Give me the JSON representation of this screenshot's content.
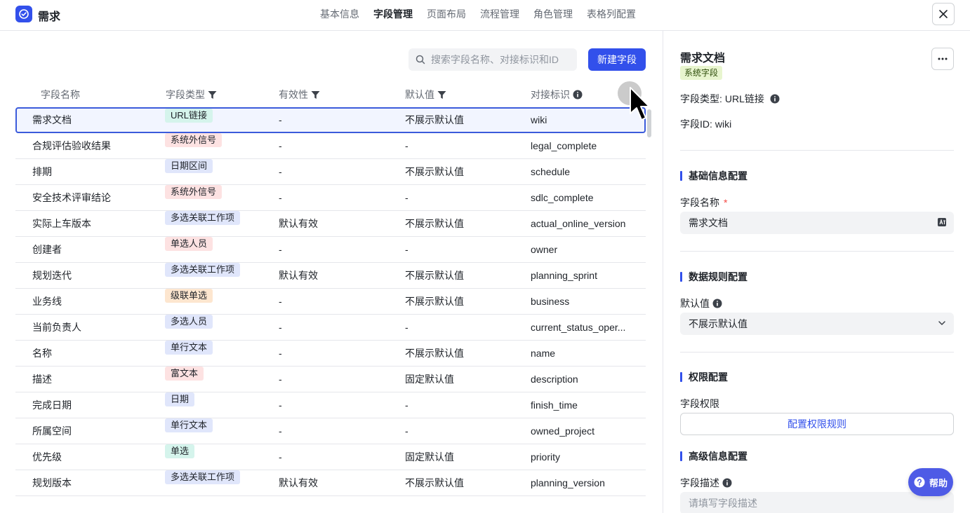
{
  "app": {
    "title": "需求"
  },
  "tabs": [
    {
      "label": "基本信息",
      "active": false
    },
    {
      "label": "字段管理",
      "active": true
    },
    {
      "label": "页面布局",
      "active": false
    },
    {
      "label": "流程管理",
      "active": false
    },
    {
      "label": "角色管理",
      "active": false
    },
    {
      "label": "表格列配置",
      "active": false
    }
  ],
  "toolbar": {
    "search_placeholder": "搜索字段名称、对接标识和ID",
    "new_button": "新建字段"
  },
  "table": {
    "headers": {
      "name": "字段名称",
      "type": "字段类型",
      "valid": "有效性",
      "default": "默认值",
      "key": "对接标识"
    },
    "rows": [
      {
        "name": "需求文档",
        "type": "URL链接",
        "type_color": "teal",
        "valid": "-",
        "default": "不展示默认值",
        "key": "wiki",
        "selected": true
      },
      {
        "name": "合规评估验收结果",
        "type": "系统外信号",
        "type_color": "red",
        "valid": "-",
        "default": "-",
        "key": "legal_complete"
      },
      {
        "name": "排期",
        "type": "日期区间",
        "type_color": "indigo",
        "valid": "-",
        "default": "不展示默认值",
        "key": "schedule"
      },
      {
        "name": "安全技术评审结论",
        "type": "系统外信号",
        "type_color": "red",
        "valid": "-",
        "default": "-",
        "key": "sdlc_complete"
      },
      {
        "name": "实际上车版本",
        "type": "多选关联工作项",
        "type_color": "indigo",
        "valid": "默认有效",
        "default": "不展示默认值",
        "key": "actual_online_version"
      },
      {
        "name": "创建者",
        "type": "单选人员",
        "type_color": "red",
        "valid": "-",
        "default": "-",
        "key": "owner"
      },
      {
        "name": "规划迭代",
        "type": "多选关联工作项",
        "type_color": "indigo",
        "valid": "默认有效",
        "default": "不展示默认值",
        "key": "planning_sprint"
      },
      {
        "name": "业务线",
        "type": "级联单选",
        "type_color": "orange",
        "valid": "-",
        "default": "不展示默认值",
        "key": "business"
      },
      {
        "name": "当前负责人",
        "type": "多选人员",
        "type_color": "indigo",
        "valid": "-",
        "default": "-",
        "key": "current_status_oper..."
      },
      {
        "name": "名称",
        "type": "单行文本",
        "type_color": "indigo",
        "valid": "-",
        "default": "不展示默认值",
        "key": "name"
      },
      {
        "name": "描述",
        "type": "富文本",
        "type_color": "red",
        "valid": "-",
        "default": "固定默认值",
        "key": "description"
      },
      {
        "name": "完成日期",
        "type": "日期",
        "type_color": "indigo",
        "valid": "-",
        "default": "-",
        "key": "finish_time"
      },
      {
        "name": "所属空间",
        "type": "单行文本",
        "type_color": "indigo",
        "valid": "-",
        "default": "-",
        "key": "owned_project"
      },
      {
        "name": "优先级",
        "type": "单选",
        "type_color": "teal",
        "valid": "-",
        "default": "固定默认值",
        "key": "priority"
      },
      {
        "name": "规划版本",
        "type": "多选关联工作项",
        "type_color": "indigo",
        "valid": "默认有效",
        "default": "不展示默认值",
        "key": "planning_version"
      }
    ]
  },
  "tag_colors": {
    "teal": {
      "bg": "#d5f4ec",
      "fg": "#1f2329"
    },
    "red": {
      "bg": "#fde2e2",
      "fg": "#1f2329"
    },
    "indigo": {
      "bg": "#e0e6fb",
      "fg": "#1f2329"
    },
    "orange": {
      "bg": "#fde6cf",
      "fg": "#1f2329"
    }
  },
  "detail": {
    "title": "需求文档",
    "badge": "系统字段",
    "field_type_label": "字段类型:",
    "field_type_value": "URL链接",
    "field_id_label": "字段ID:",
    "field_id_value": "wiki",
    "section_basic": "基础信息配置",
    "name_label": "字段名称",
    "name_required": "*",
    "name_value": "需求文档",
    "section_data": "数据规则配置",
    "default_label": "默认值",
    "default_value": "不展示默认值",
    "section_perm": "权限配置",
    "perm_label": "字段权限",
    "perm_button": "配置权限规则",
    "section_adv": "高级信息配置",
    "desc_label": "字段描述",
    "desc_placeholder": "请填写字段描述"
  },
  "help": {
    "label": "帮助"
  },
  "colors": {
    "accent": "#3250eb",
    "selected_border": "#3b5bdb"
  }
}
